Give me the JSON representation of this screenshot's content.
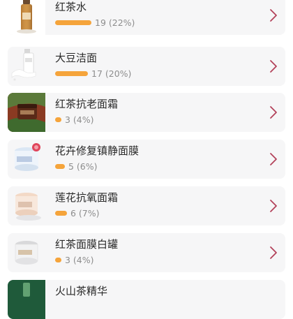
{
  "accent_bar_color": "#f5a43b",
  "chevron_color": "#b3425a",
  "items": [
    {
      "name": "红茶水",
      "count_text": "19 (22%)",
      "share": 0.22
    },
    {
      "name": "大豆洁面",
      "count_text": "17 (20%)",
      "share": 0.2
    },
    {
      "name": "红茶抗老面霜",
      "count_text": "3 (4%)",
      "share": 0.04
    },
    {
      "name": "花卉修复镇静面膜",
      "count_text": "5 (6%)",
      "share": 0.06
    },
    {
      "name": "莲花抗氧面霜",
      "count_text": "6 (7%)",
      "share": 0.07
    },
    {
      "name": "红茶面膜白罐",
      "count_text": "3 (4%)",
      "share": 0.04
    },
    {
      "name": "火山茶精华",
      "count_text": "",
      "share": null
    }
  ]
}
